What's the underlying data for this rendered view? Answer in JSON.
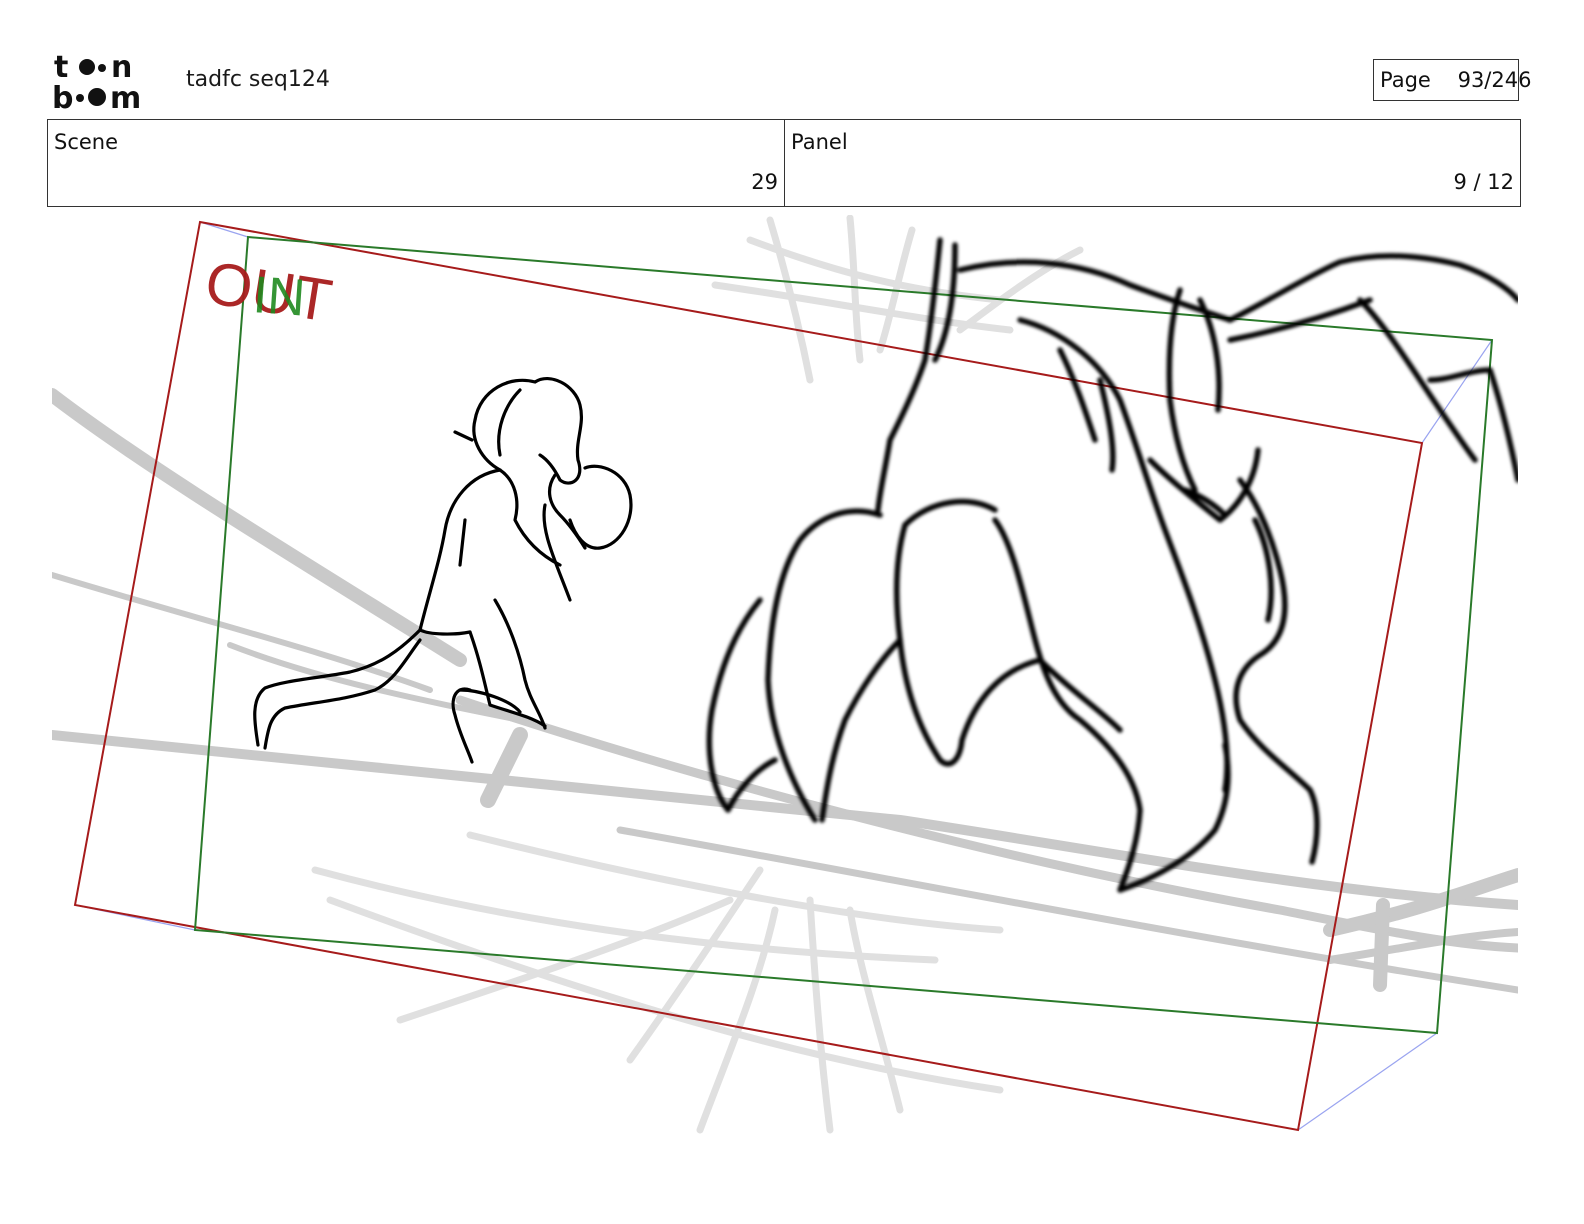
{
  "header": {
    "logo_text": "toon boom",
    "document_title": "tadfc seq124",
    "page_label": "Page",
    "page_value": "93/246"
  },
  "info": {
    "scene_label": "Scene",
    "scene_value": "29",
    "panel_label": "Panel",
    "panel_value": "9 / 12"
  },
  "frame_labels": {
    "out_label": "OUT",
    "in_label": "IN",
    "out_color": "#a61b1b",
    "in_color": "#1f8a1f"
  },
  "colors": {
    "sketch_line": "#000000",
    "background_sketch": "#c9c9c9",
    "out_frame": "#a61b1b",
    "in_frame": "#2a7a2a",
    "camera_path": "#9aa4f0"
  }
}
